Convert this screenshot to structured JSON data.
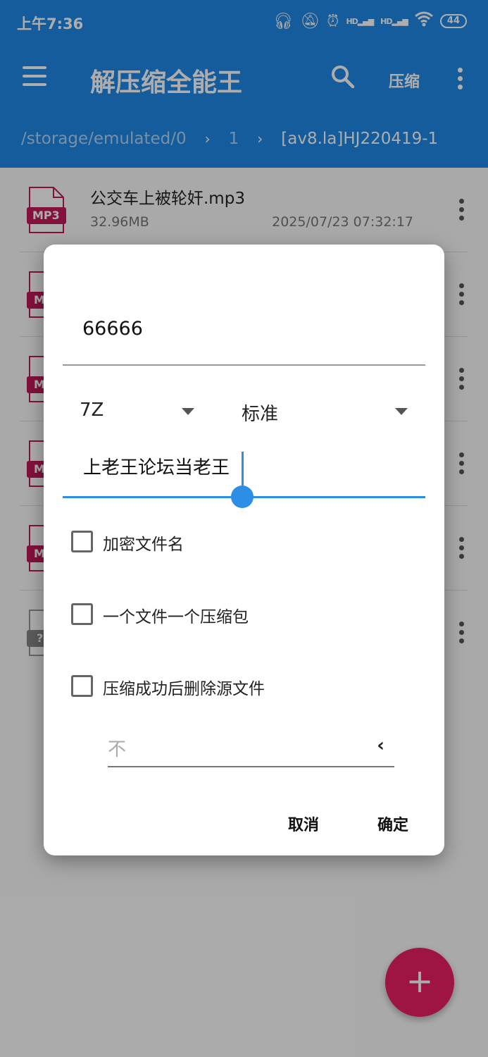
{
  "status_bar": {
    "time": "上午7:36",
    "signal1": "HD",
    "signal2": "HD",
    "battery": "44"
  },
  "toolbar": {
    "title": "解压缩全能王",
    "compress_label": "压缩"
  },
  "breadcrumb": {
    "items": [
      "/storage/emulated/0",
      "1",
      "[av8.la]HJ220419-1"
    ]
  },
  "files": [
    {
      "name": "公交车上被轮奸.mp3",
      "size": "32.96MB",
      "date": "2025/07/23 07:32:17",
      "type_label": "MP3"
    },
    {
      "type_label": "M"
    },
    {
      "type_label": "M"
    },
    {
      "type_label": "M"
    },
    {
      "type_label": "M"
    },
    {
      "type_label": "?"
    }
  ],
  "dialog": {
    "archive_name": "66666",
    "format": "7Z",
    "level": "标准",
    "password": "上老王论坛当老王",
    "options": [
      {
        "label": "加密文件名",
        "checked": false
      },
      {
        "label": "一个文件一个压缩包",
        "checked": false
      },
      {
        "label": "压缩成功后删除源文件",
        "checked": false
      }
    ],
    "split_value": "不",
    "cancel_label": "取消",
    "ok_label": "确定"
  },
  "colors": {
    "primary": "#1e88e5",
    "accent": "#e91e63",
    "focus": "#2d8ee6"
  }
}
